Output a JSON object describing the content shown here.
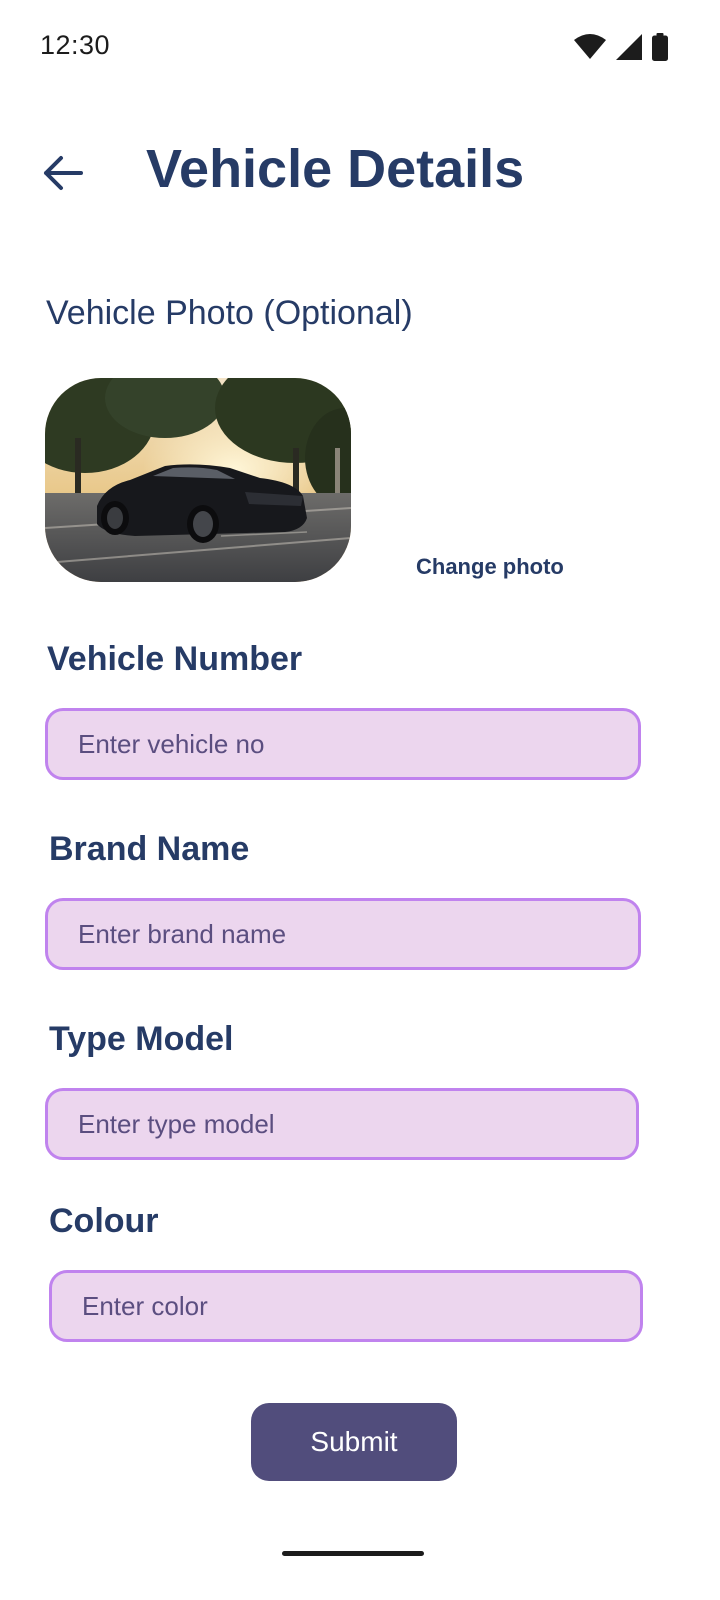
{
  "status_bar": {
    "time": "12:30",
    "icons": [
      "wifi-icon",
      "cellular-signal-icon",
      "battery-icon"
    ]
  },
  "header": {
    "back_icon": "arrow-left-icon",
    "title": "Vehicle Details"
  },
  "photo_section": {
    "label": "Vehicle Photo (Optional)",
    "change_label": "Change photo"
  },
  "form": {
    "vehicle_number": {
      "label": "Vehicle Number",
      "placeholder": "Enter vehicle no",
      "value": ""
    },
    "brand_name": {
      "label": "Brand Name",
      "placeholder": "Enter brand name",
      "value": ""
    },
    "type_model": {
      "label": "Type Model",
      "placeholder": "Enter type model",
      "value": ""
    },
    "colour": {
      "label": "Colour",
      "placeholder": "Enter color",
      "value": ""
    }
  },
  "submit_label": "Submit",
  "colors": {
    "primary_text": "#263b66",
    "input_fill": "#ecd6ee",
    "input_border": "#c083ee",
    "button": "#514d7c"
  }
}
